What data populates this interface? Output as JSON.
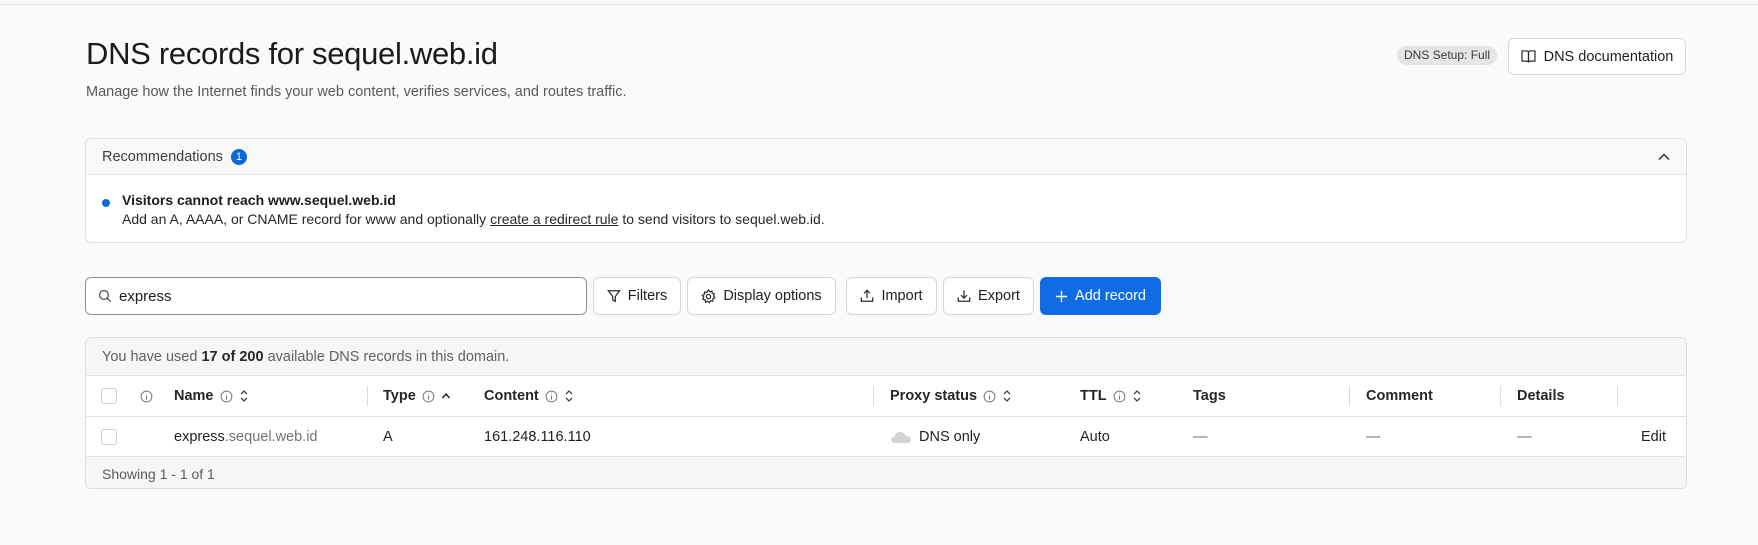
{
  "header": {
    "title": "DNS records for sequel.web.id",
    "subtitle": "Manage how the Internet finds your web content, verifies services, and routes traffic.",
    "setup_badge": "DNS Setup: Full",
    "doc_button": "DNS documentation"
  },
  "recommendations": {
    "label": "Recommendations",
    "count": "1",
    "item_title": "Visitors cannot reach www.sequel.web.id",
    "item_desc_before": "Add an A, AAAA, or CNAME record for www and optionally ",
    "item_link": "create a redirect rule",
    "item_desc_after": " to send visitors to sequel.web.id."
  },
  "toolbar": {
    "search_value": "express",
    "filters": "Filters",
    "display_options": "Display options",
    "import": "Import",
    "export": "Export",
    "add_record": "Add record"
  },
  "usage": {
    "prefix": "You have used ",
    "count": "17 of 200",
    "suffix": " available DNS records in this domain."
  },
  "table": {
    "columns": {
      "name": "Name",
      "type": "Type",
      "content": "Content",
      "proxy": "Proxy status",
      "ttl": "TTL",
      "tags": "Tags",
      "comment": "Comment",
      "details": "Details"
    },
    "rows": [
      {
        "name_sub": "express",
        "name_domain": ".sequel.web.id",
        "type": "A",
        "content": "161.248.116.110",
        "proxy": "DNS only",
        "ttl": "Auto",
        "tags": "—",
        "comment": "—",
        "details": "—",
        "edit": "Edit"
      }
    ],
    "footer": "Showing 1 - 1 of 1"
  },
  "colors": {
    "accent": "#0f6ce3",
    "badge_blue": "#0b69d9"
  }
}
